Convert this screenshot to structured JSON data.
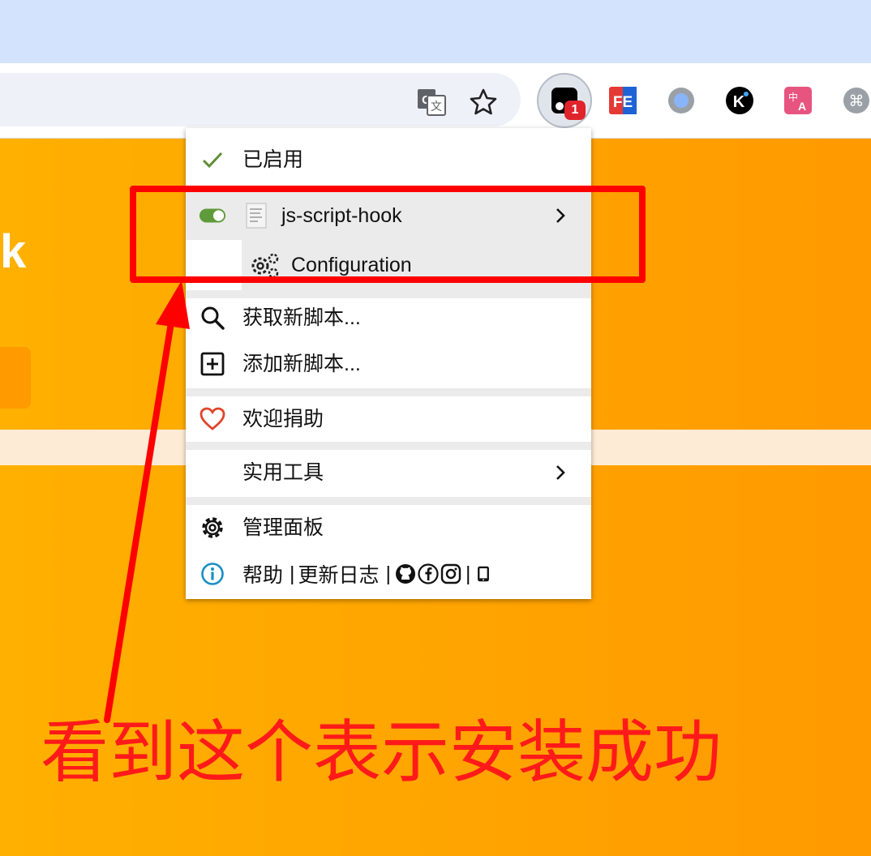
{
  "page": {
    "heading": "k"
  },
  "browser": {
    "badge_count": "1",
    "extensions": [
      {
        "name": "tampermonkey-icon"
      },
      {
        "name": "fe-helper-icon",
        "label": "FE"
      },
      {
        "name": "grey-circle-extension-icon"
      },
      {
        "name": "k-extension-icon",
        "label": "K"
      },
      {
        "name": "translate-extension-icon"
      },
      {
        "name": "command-extension-icon",
        "label": "⌘"
      }
    ]
  },
  "menu": {
    "enabled_label": "已启用",
    "script_name": "js-script-hook",
    "config_label": "Configuration",
    "find_scripts": "获取新脚本...",
    "add_script": "添加新脚本...",
    "donate": "欢迎捐助",
    "utilities": "实用工具",
    "dashboard": "管理面板",
    "help": "帮助",
    "separator": "|",
    "changelog": "更新日志"
  },
  "annotation": {
    "caption": "看到这个表示安装成功"
  },
  "colors": {
    "tabstrip": "#d3e3fd",
    "page_orange": "#ffa500",
    "highlight_red": "#ff0000",
    "toggle_green": "#5f9b3a"
  }
}
